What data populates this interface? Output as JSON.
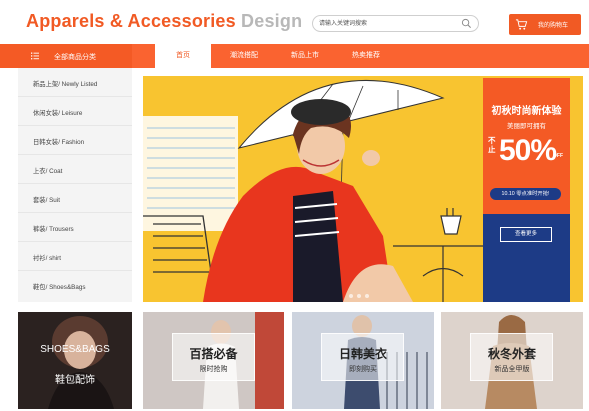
{
  "brand": {
    "title_part1": "Apparels & Accessories",
    "title_part2": "Design"
  },
  "search": {
    "placeholder": "请输入关键词搜索",
    "icon": "search-icon"
  },
  "cart": {
    "label": "我的购物车",
    "icon": "cart-icon"
  },
  "categories_button": {
    "label": "全部商品分类",
    "icon": "menu-icon"
  },
  "nav": {
    "items": [
      {
        "label": "首页",
        "active": true
      },
      {
        "label": "潮流搭配",
        "active": false
      },
      {
        "label": "新品上市",
        "active": false
      },
      {
        "label": "热卖推荐",
        "active": false
      }
    ]
  },
  "sidebar": {
    "items": [
      {
        "label": "新品上架/ Newly Listed"
      },
      {
        "label": "休闲女装/ Leisure"
      },
      {
        "label": "日韩女装/ Fashion"
      },
      {
        "label": "上衣/ Coat"
      },
      {
        "label": "套装/ Suit"
      },
      {
        "label": "裤装/ Trousers"
      },
      {
        "label": "衬衫/ shirt"
      },
      {
        "label": "鞋包/ Shoes&Bags"
      }
    ]
  },
  "banner": {
    "promo_title": "初秋时尚新体验",
    "promo_subtitle": "美丽即可拥有",
    "promo_side_text": "不止",
    "promo_discount": "50%",
    "promo_off": "OFF",
    "promo_tag": "10.10 零点准时开抢!",
    "promo_button": "查看更多"
  },
  "tiles": [
    {
      "title": "SHOES&BAGS",
      "subtitle": "鞋包配饰"
    },
    {
      "title": "百搭必备",
      "subtitle": "限时抢购"
    },
    {
      "title": "日韩美衣",
      "subtitle": "即刻购买"
    },
    {
      "title": "秋冬外套",
      "subtitle": "新品全甲版"
    }
  ],
  "colors": {
    "accent": "#f15a24",
    "nav_bar": "#fa6330",
    "promo_blue": "#1d3b86",
    "banner_yellow": "#f8c430"
  }
}
